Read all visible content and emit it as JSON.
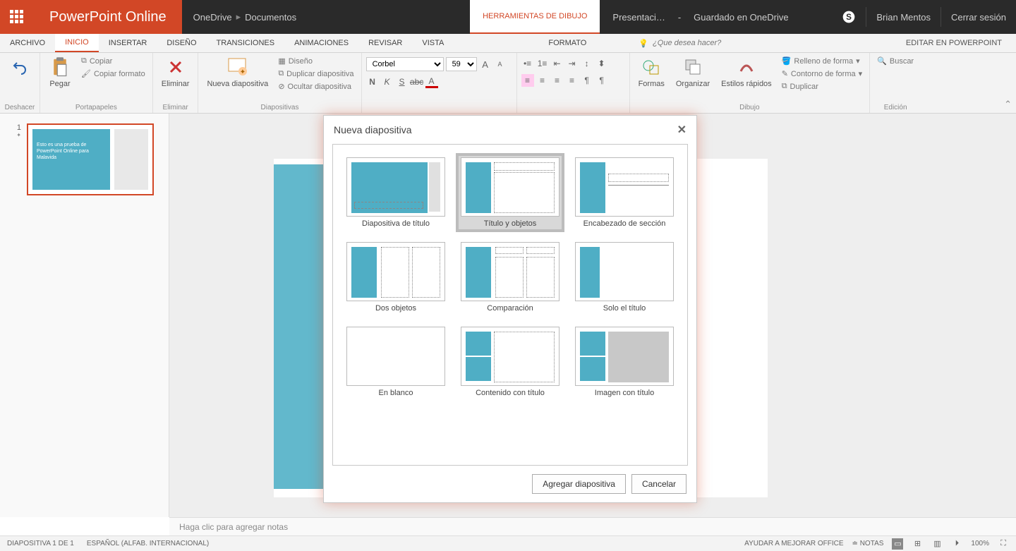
{
  "titlebar": {
    "app": "PowerPoint Online",
    "breadcrumb": [
      "OneDrive",
      "Documentos"
    ],
    "tool_tab": "HERRAMIENTAS DE DIBUJO",
    "doc_name": "Presentaci…",
    "save_status": "Guardado en OneDrive",
    "user": "Brian Mentos",
    "signout": "Cerrar sesión"
  },
  "tabs": {
    "archivo": "ARCHIVO",
    "inicio": "INICIO",
    "insertar": "INSERTAR",
    "diseno": "DISEÑO",
    "transiciones": "TRANSICIONES",
    "animaciones": "ANIMACIONES",
    "revisar": "REVISAR",
    "vista": "VISTA",
    "formato": "FORMATO",
    "tell_placeholder": "¿Que desea hacer?",
    "edit_pp": "EDITAR EN POWERPOINT"
  },
  "ribbon": {
    "deshacer": "Deshacer",
    "pegar": "Pegar",
    "copiar": "Copiar",
    "copiar_formato": "Copiar formato",
    "portapapeles": "Portapapeles",
    "eliminar": "Eliminar",
    "eliminar_group": "Eliminar",
    "nueva_diap": "Nueva diapositiva",
    "diseno_btn": "Diseño",
    "duplicar_diap": "Duplicar diapositiva",
    "ocultar_diap": "Ocultar diapositiva",
    "diapositivas": "Diapositivas",
    "font_name": "Corbel",
    "font_size": "59",
    "formas": "Formas",
    "organizar": "Organizar",
    "estilos": "Estilos rápidos",
    "relleno": "Relleno de forma",
    "contorno": "Contorno de forma",
    "duplicar": "Duplicar",
    "dibujo": "Dibujo",
    "buscar": "Buscar",
    "edicion": "Edición"
  },
  "slide_thumb": {
    "num": "1",
    "text": "Esto es una prueba de PowerPoint Online para Malavida"
  },
  "dialog": {
    "title": "Nueva diapositiva",
    "layouts": [
      "Diapositiva de título",
      "Título y objetos",
      "Encabezado de sección",
      "Dos objetos",
      "Comparación",
      "Solo el título",
      "En blanco",
      "Contenido con título",
      "Imagen con título"
    ],
    "add": "Agregar diapositiva",
    "cancel": "Cancelar"
  },
  "notes": {
    "placeholder": "Haga clic para agregar notas"
  },
  "status": {
    "slide": "DIAPOSITIVA 1 DE 1",
    "lang": "ESPAÑOL (ALFAB. INTERNACIONAL)",
    "improve": "AYUDAR A MEJORAR OFFICE",
    "notas": "NOTAS",
    "zoom": "100%"
  }
}
